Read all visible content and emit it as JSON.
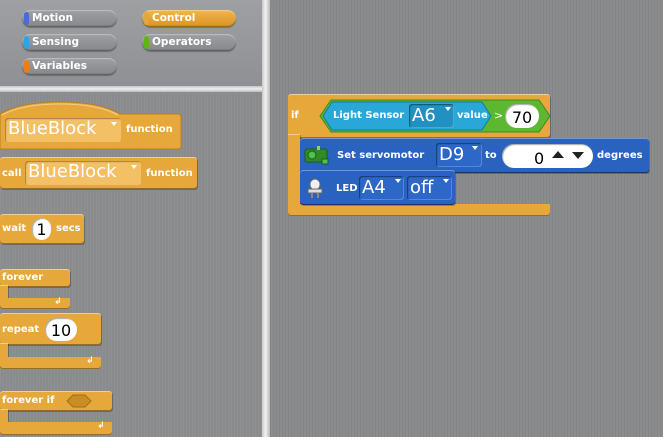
{
  "categories": [
    {
      "label": "Motion",
      "color": "#4a6cd4"
    },
    {
      "label": "Control",
      "color": "#e1a73d"
    },
    {
      "label": "Sensing",
      "color": "#2ca5e2"
    },
    {
      "label": "Operators",
      "color": "#5cb712"
    },
    {
      "label": "Variables",
      "color": "#ee7d16"
    }
  ],
  "palette": {
    "function_def": {
      "name": "BlueBlock",
      "label": "function"
    },
    "call": {
      "label": "call",
      "name": "BlueBlock",
      "suffix": "function"
    },
    "wait": {
      "label": "wait",
      "value": "1",
      "unit": "secs"
    },
    "forever": {
      "label": "forever"
    },
    "repeat": {
      "label": "repeat",
      "value": "10"
    },
    "forever_if": {
      "label": "forever if"
    }
  },
  "script": {
    "if_label": "if",
    "light_sensor": {
      "label": "Light Sensor",
      "pin": "A6",
      "value_label": "value",
      "operator": ">",
      "threshold": "70"
    },
    "servo": {
      "label": "Set servomotor",
      "pin": "D9",
      "to_label": "to",
      "angle": "0",
      "unit": "degrees"
    },
    "led": {
      "label": "LED",
      "pin": "A4",
      "state": "off"
    }
  }
}
